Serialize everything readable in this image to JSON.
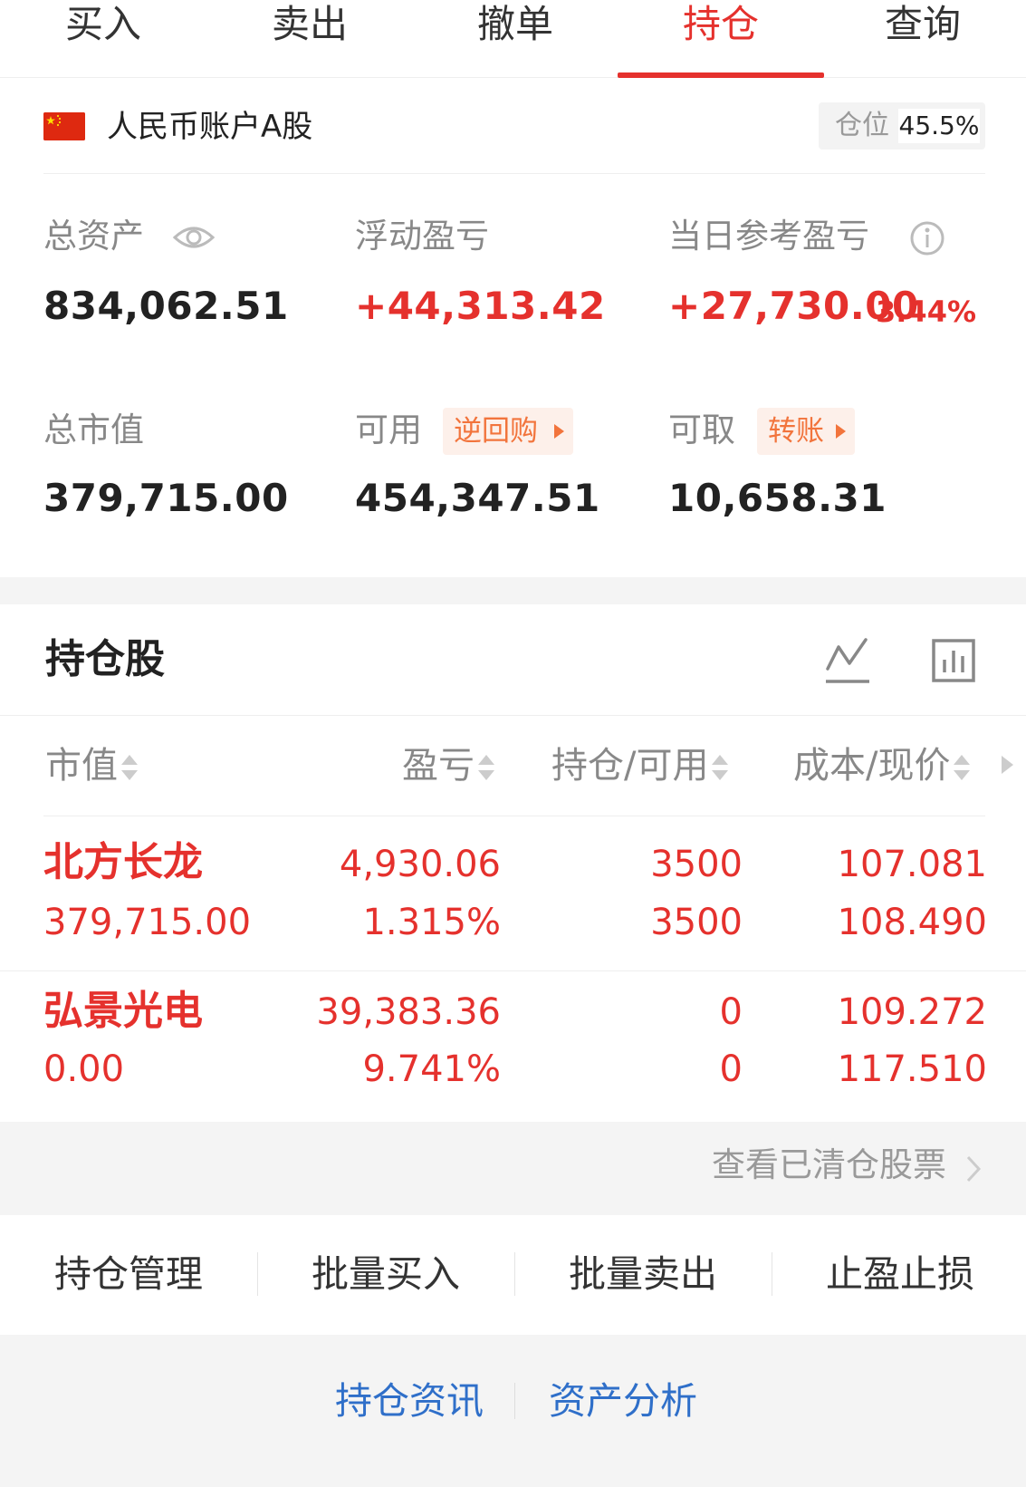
{
  "tabs": [
    {
      "label": "买入"
    },
    {
      "label": "卖出"
    },
    {
      "label": "撤单"
    },
    {
      "label": "持仓",
      "active": true
    },
    {
      "label": "查询"
    }
  ],
  "account": {
    "name": "人民币账户A股",
    "flag_icon": "china-flag-icon",
    "position_label": "仓位",
    "position_value": "45.5%"
  },
  "summary": {
    "total_assets": {
      "label": "总资产",
      "value": "834,062.51"
    },
    "floating_pnl": {
      "label": "浮动盈亏",
      "value": "+44,313.42"
    },
    "daily_pnl": {
      "label": "当日参考盈亏",
      "value": "+27,730.00",
      "percent": "3.44%"
    },
    "market_value": {
      "label": "总市值",
      "value": "379,715.00"
    },
    "available": {
      "label": "可用",
      "value": "454,347.51",
      "tag": "逆回购"
    },
    "withdrawable": {
      "label": "可取",
      "value": "10,658.31",
      "tag": "转账"
    }
  },
  "holdings": {
    "title": "持仓股",
    "columns": [
      "市值",
      "盈亏",
      "持仓/可用",
      "成本/现价"
    ],
    "rows": [
      {
        "name": "北方长龙",
        "market_value": "379,715.00",
        "pnl": "4,930.06",
        "pnl_pct": "1.315%",
        "position": "3500",
        "available": "3500",
        "cost": "107.081",
        "price": "108.490"
      },
      {
        "name": "弘景光电",
        "market_value": "0.00",
        "pnl": "39,383.36",
        "pnl_pct": "9.741%",
        "position": "0",
        "available": "0",
        "cost": "109.272",
        "price": "117.510"
      }
    ],
    "cleared_link": "查看已清仓股票"
  },
  "actions": [
    "持仓管理",
    "批量买入",
    "批量卖出",
    "止盈止损"
  ],
  "bottom_links": [
    "持仓资讯",
    "资产分析"
  ],
  "colors": {
    "accent": "#e5312d",
    "tag_orange": "#f2743c",
    "link_blue": "#2f6fc9"
  }
}
